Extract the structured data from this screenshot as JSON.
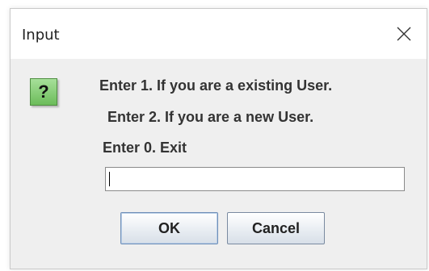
{
  "dialog": {
    "title": "Input",
    "icon": "question-icon",
    "icon_glyph": "?",
    "messages": [
      "Enter 1. If you are a existing User.",
      "Enter 2. If you are a new User.",
      "Enter 0. Exit"
    ],
    "input": {
      "value": "",
      "placeholder": ""
    },
    "buttons": {
      "ok": "OK",
      "cancel": "Cancel"
    },
    "colors": {
      "icon_green": "#6cbc5a",
      "background": "#efefef"
    }
  }
}
